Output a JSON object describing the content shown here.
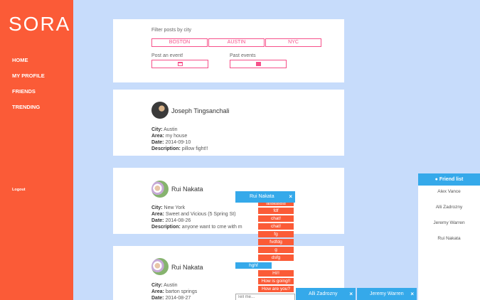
{
  "app": {
    "logo": "SORA"
  },
  "sidebar": {
    "items": [
      {
        "label": "HOME"
      },
      {
        "label": "MY PROFILE"
      },
      {
        "label": "FRIENDS"
      },
      {
        "label": "TRENDING"
      }
    ],
    "logout": "Logout"
  },
  "filter": {
    "label": "Filter posts by city",
    "cities": [
      "BOSTON",
      "AUSTIN",
      "NYC"
    ],
    "post_event": "Post an event!",
    "past_events": "Past events"
  },
  "posts": [
    {
      "author": "Joseph Tingsanchali",
      "city": "Austin",
      "area": "my house",
      "date": "2014-09-10",
      "description": "pillow fight!!"
    },
    {
      "author": "Rui Nakata",
      "city": "New York",
      "area": "Sweet and Vicious (5 Spring St)",
      "date": "2014-08-26",
      "description": "anyone want to cme with m"
    },
    {
      "author": "Rui Nakata",
      "city": "Austin",
      "area": "barton springs",
      "date": "2014-08-27"
    }
  ],
  "labels": {
    "city": "City:",
    "area": "Area:",
    "date": "Date:",
    "description": "Description:"
  },
  "chat": {
    "title": "Rui Nakata",
    "close": "×",
    "messages": [
      {
        "text": "lalsdkalsdsd",
        "mine": false
      },
      {
        "text": "fdf",
        "mine": false
      },
      {
        "text": "chat!",
        "mine": false
      },
      {
        "text": "chat!",
        "mine": false
      },
      {
        "text": "fg",
        "mine": false
      },
      {
        "text": "fvdfdg",
        "mine": false
      },
      {
        "text": "g",
        "mine": false
      },
      {
        "text": "dsfg",
        "mine": false
      },
      {
        "text": "hghf",
        "mine": true
      },
      {
        "text": "Hi!!",
        "mine": false
      },
      {
        "text": "How is going!!",
        "mine": false
      },
      {
        "text": "How are you?",
        "mine": false
      }
    ],
    "input_placeholder": "Tell me..."
  },
  "friends": {
    "title": "Friend list",
    "items": [
      "Alex Vance",
      "Alli Zadrozny",
      "Jeremy Warren",
      "Rui Nakata"
    ]
  },
  "tabs": [
    {
      "name": "Alli Zadrozny",
      "close": "×"
    },
    {
      "name": "Jeremy Warren",
      "close": "×"
    }
  ],
  "colors": {
    "sidebar": "#fb5b37",
    "accent_pink": "#f6508a",
    "chat_blue": "#35a9ea",
    "background": "#c7dcfb"
  }
}
